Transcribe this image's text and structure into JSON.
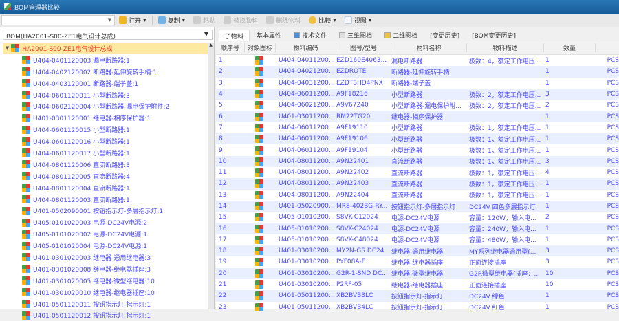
{
  "window": {
    "title": "BOM管理器比较"
  },
  "toolbar": {
    "search_value": "",
    "open": "打开",
    "copy": "复制",
    "paste": "粘贴",
    "replace": "替换物料",
    "delete": "删除物料",
    "compare": "比较",
    "view": "视图"
  },
  "colors": {
    "title": "#1c5f9e",
    "link": "#4a4aff",
    "root": "#f03b1e",
    "selected": "#fdeaa0"
  },
  "left": {
    "bom_select": "BOM(HA2001-S00-ZE1电气设计总成)",
    "root": "HA2001-S00-ZE1电气设计总成",
    "items": [
      "U404-0401120003 漏电断路器:1",
      "U404-0402120002 断路器-延伸旋转手柄:1",
      "U404-0403120001 断路器-端子盖:1",
      "U404-0601120011 小型断路器:3",
      "U404-0602120004 小型断路器-漏电保护附件:2",
      "U401-0301120001 继电器-相序保护器:1",
      "U404-0601120015 小型断路器:1",
      "U404-0601120016 小型断路器:1",
      "U404-0601120017 小型断路器:1",
      "U404-0801120006 直流断路器:3",
      "U404-0801120005 直流断路器:4",
      "U404-0801120004 直流断路器:1",
      "U404-0801120003 直流断路器:1",
      "U401-0502090001 按钮指示灯-多层指示灯:1",
      "U405-0101020003 电源-DC24V电源:2",
      "U405-0101020002 电源-DC24V电源:1",
      "U405-0101020004 电源-DC24V电源:1",
      "U401-0301020003 继电器-通用继电器:3",
      "U401-0301020008 继电器-继电器插座:3",
      "U401-0301020005 继电器-微型继电器:10",
      "U401-0301020010 继电器-继电器插座:10",
      "U401-0501120011 按钮指示灯-指示灯:1",
      "U401-0501120012 按钮指示灯-指示灯:1"
    ]
  },
  "tabs": [
    "子物料",
    "基本属性",
    "技术文件",
    "三维图档",
    "二维图档",
    "[变更历史]",
    "[BOM变更历史]"
  ],
  "table": {
    "headers": [
      "顺序号",
      "对象图标",
      "物料编码",
      "图号/型号",
      "物料名称",
      "物料描述",
      "数量",
      ""
    ],
    "rows": [
      [
        "1",
        "U404-0401120003",
        "EZD160E4063...",
        "漏电断路器",
        "极数：4，额定工作电压...",
        "1",
        "PCS"
      ],
      [
        "2",
        "U404-0402120002",
        "EZDROTE",
        "断路器-延伸旋转手柄",
        "",
        "1",
        "PCS"
      ],
      [
        "3",
        "U404-0403120001",
        "EZDTSHD4PNX",
        "断路器-端子盖",
        "",
        "1",
        "PCS"
      ],
      [
        "4",
        "U404-0601120011",
        "A9F18216",
        "小型断路器",
        "极数：2，额定工作电压...",
        "3",
        "PCS"
      ],
      [
        "5",
        "U404-0602120004",
        "A9V67240",
        "小型断路器-漏电保护附...",
        "极数：2，额定工作电压...",
        "2",
        "PCS"
      ],
      [
        "6",
        "U401-0301120001",
        "RM22TG20",
        "继电器-相序保护器",
        "",
        "1",
        "PCS"
      ],
      [
        "7",
        "U404-0601120015",
        "A9F19110",
        "小型断路器",
        "极数：1，额定工作电压...",
        "1",
        "PCS"
      ],
      [
        "8",
        "U404-0601120016",
        "A9F19106",
        "小型断路器",
        "极数：1，额定工作电压...",
        "1",
        "PCS"
      ],
      [
        "9",
        "U404-0601120017",
        "A9F19104",
        "小型断路器",
        "极数：1，额定工作电压...",
        "1",
        "PCS"
      ],
      [
        "10",
        "U404-0801120006",
        "A9N22401",
        "直流断路器",
        "极数：1，额定工作电压...",
        "3",
        "PCS"
      ],
      [
        "11",
        "U404-0801120005",
        "A9N22402",
        "直流断路器",
        "极数：1，额定工作电压...",
        "4",
        "PCS"
      ],
      [
        "12",
        "U404-0801120004",
        "A9N22403",
        "直流断路器",
        "极数：1，额定工作电压...",
        "1",
        "PCS"
      ],
      [
        "13",
        "U404-0801120003",
        "A9N22404",
        "直流断路器",
        "极数：1，额定工作电压...",
        "1",
        "PCS"
      ],
      [
        "14",
        "U401-0502090001",
        "MR8-402BG-RY...",
        "按钮指示灯-多层指示灯",
        "DC24V 四色多层指示灯",
        "1",
        "PCS"
      ],
      [
        "15",
        "U405-0101020003",
        "S8VK-C12024",
        "电源-DC24V电源",
        "容量：120W，输入电...",
        "2",
        "PCS"
      ],
      [
        "16",
        "U405-0101020002",
        "S8VK-C24024",
        "电源-DC24V电源",
        "容量：240W，输入电...",
        "1",
        "PCS"
      ],
      [
        "17",
        "U405-0101020004",
        "S8VK-C48024",
        "电源-DC24V电源",
        "容量：480W，输入电...",
        "1",
        "PCS"
      ],
      [
        "18",
        "U401-0301020003",
        "MY2N-GS DC24",
        "继电器-通用继电器",
        "MY系列继电器通用型(...",
        "3",
        "PCS"
      ],
      [
        "19",
        "U401-0301020008",
        "PYF08A-E",
        "继电器-继电器插座",
        "正面连接插座",
        "3",
        "PCS"
      ],
      [
        "20",
        "U401-0301020005",
        "G2R-1-SND DC...",
        "继电器-微型继电器",
        "G2R微型继电器(插座：...",
        "10",
        "PCS"
      ],
      [
        "21",
        "U401-0301020010",
        "P2RF-05",
        "继电器-继电器插座",
        "正面连接插座",
        "10",
        "PCS"
      ],
      [
        "22",
        "U401-0501120011",
        "XB2BVB3LC",
        "按钮指示灯-指示灯",
        "DC24V 绿色",
        "1",
        "PCS"
      ],
      [
        "23",
        "U401-0501120012",
        "XB2BVB4LC",
        "按钮指示灯-指示灯",
        "DC24V 红色",
        "1",
        "PCS"
      ]
    ]
  }
}
